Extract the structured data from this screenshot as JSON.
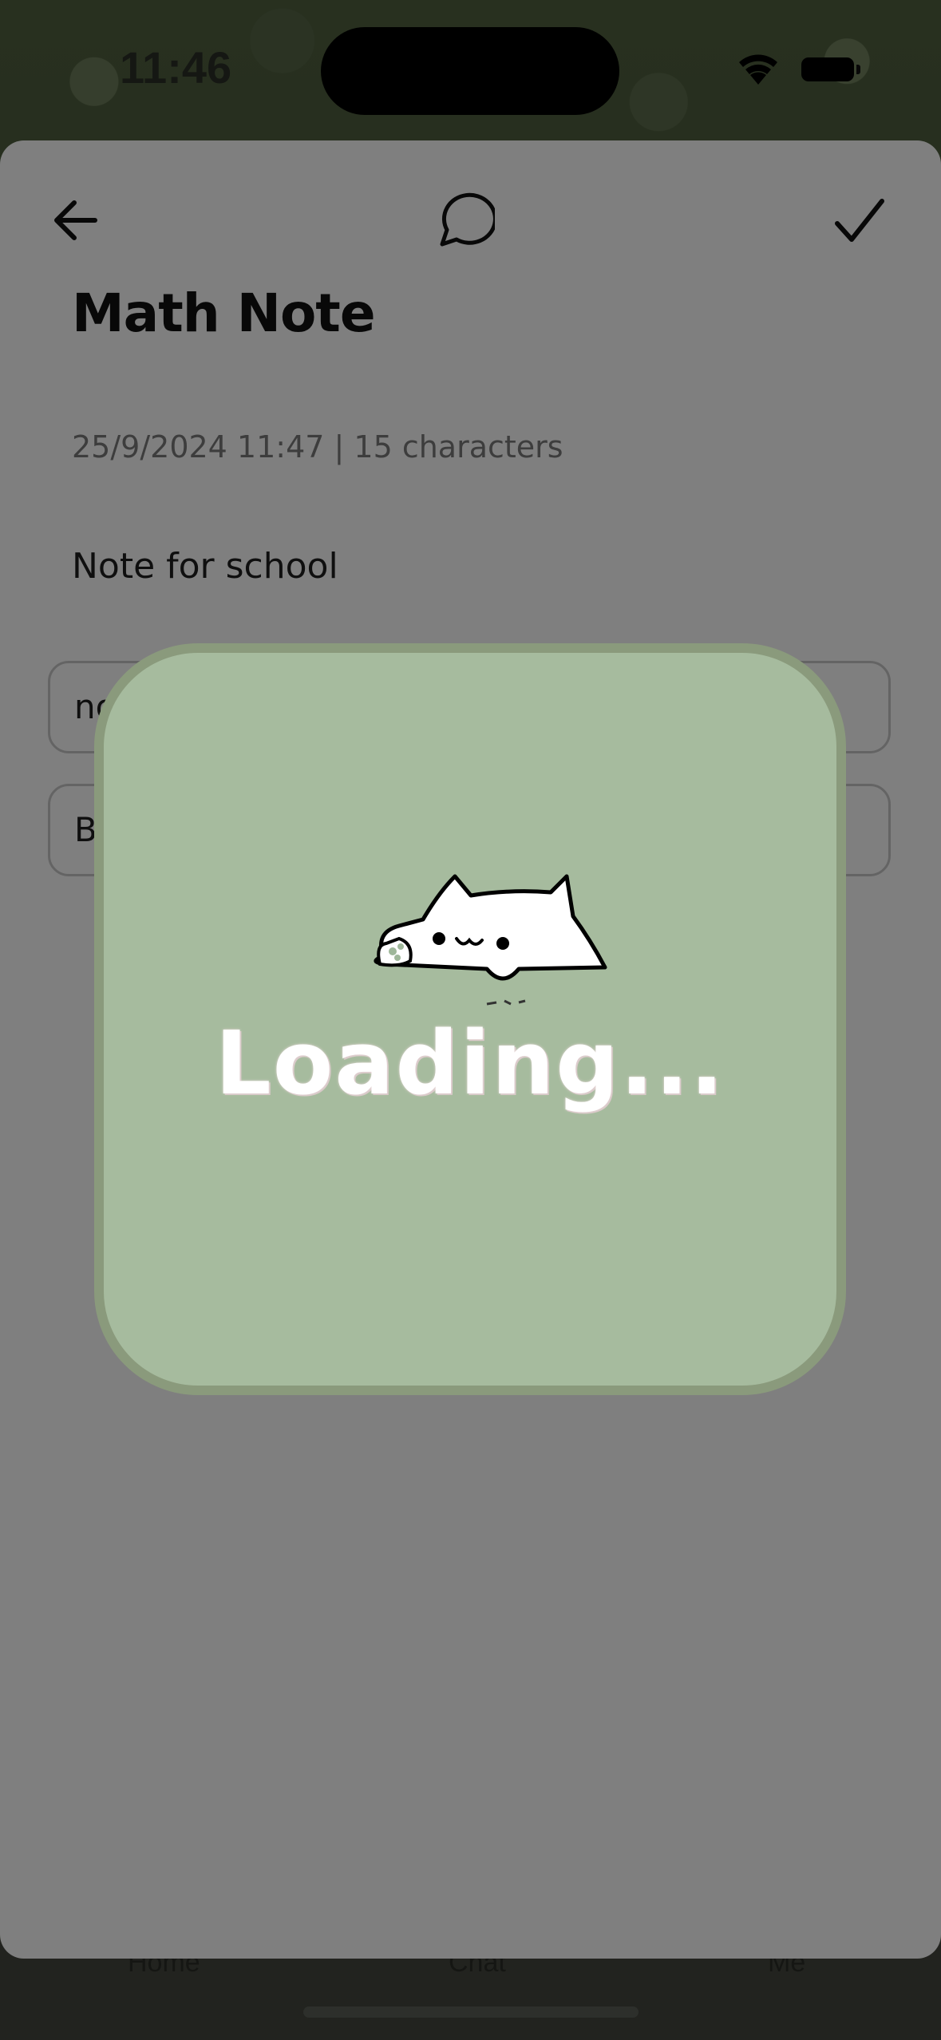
{
  "status_bar": {
    "time": "11:46",
    "icons": [
      "wifi-icon",
      "battery-icon"
    ]
  },
  "note_sheet": {
    "nav": {
      "back_icon": "arrow-left-icon",
      "comment_icon": "speech-bubble-icon",
      "save_icon": "checkmark-icon"
    },
    "title": "Math Note",
    "meta": "25/9/2024 11:47 | 15 characters",
    "body": "Note for school",
    "fields": [
      {
        "value": "no"
      },
      {
        "value": "B"
      }
    ]
  },
  "tab_bar": {
    "items": [
      "Home",
      "Chat",
      "Me"
    ]
  },
  "loading_overlay": {
    "label": "Loading...",
    "card_color": "#a6bb9e",
    "border_color": "#8a9a7c",
    "mascot_icon": "cat-mascot-icon"
  }
}
